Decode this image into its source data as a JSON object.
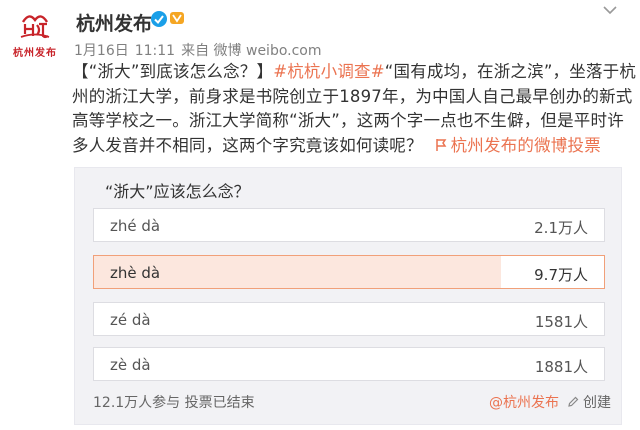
{
  "user": {
    "logo_text": "杭州发布",
    "name": "杭州发布"
  },
  "meta": {
    "date": "1月16日",
    "time": "11:11",
    "source": "来自 微博 weibo.com"
  },
  "post": {
    "lead": "【“浙大”到底该怎么念？】",
    "topic": "#杭杭小调查#",
    "body": "“国有成均，在浙之滨”，坐落于杭州的浙江大学，前身求是书院创立于1897年，为中国人自己最早创办的新式高等学校之一。浙江大学简称“浙大”，这两个字一点也不生僻，但是平时许多人发音并不相同，这两个字究竟该如何读呢？",
    "link_icon": "poll-link-icon",
    "link_text": "杭州发布的微博投票"
  },
  "poll": {
    "question": "“浙大”应该怎么念？",
    "options": [
      {
        "label": "zhé dà",
        "count": "2.1万人",
        "votes_wan": 2.1,
        "selected": false
      },
      {
        "label": "zhè dà",
        "count": "9.7万人",
        "votes_wan": 9.7,
        "selected": true
      },
      {
        "label": "zé dà",
        "count": "1581人",
        "votes_wan": 0.1581,
        "selected": false
      },
      {
        "label": "zè dà",
        "count": "1881人",
        "votes_wan": 0.1881,
        "selected": false
      }
    ],
    "footer": "12.1万人参与 投票已结束",
    "owner": "@杭州发布",
    "create_label": "创建"
  },
  "colors": {
    "accent": "#eb7350",
    "brand_red": "#c8242a",
    "selected_fill": "#fce7de"
  }
}
